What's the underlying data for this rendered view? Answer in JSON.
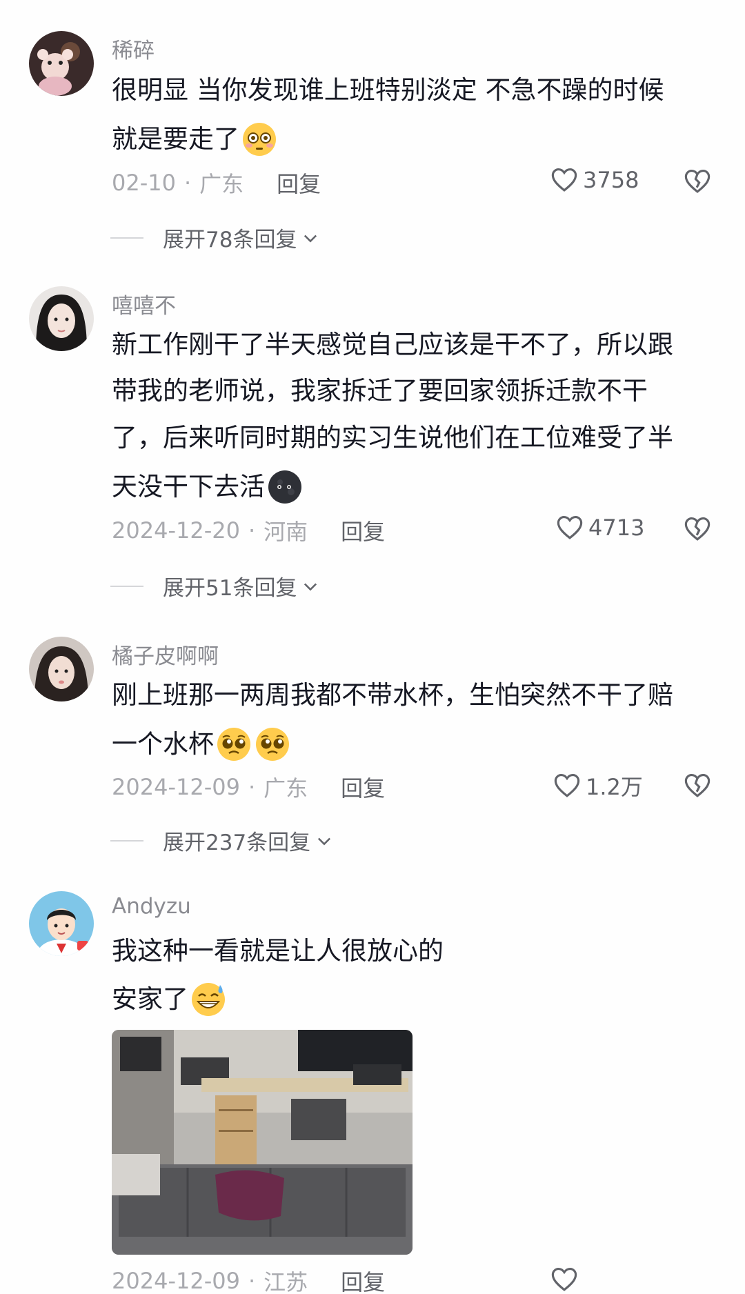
{
  "comments": [
    {
      "username": "稀碎",
      "lines": [
        "很明显 当你发现谁上班特别淡定 不急不躁的时候",
        "就是要走了"
      ],
      "emoji": "flushed-face-emoji",
      "date": "02-10",
      "region": "广东",
      "reply_label": "回复",
      "likes": "3758",
      "expand_label": "展开78条回复"
    },
    {
      "username": "嘻嘻不",
      "lines": [
        "新工作刚干了半天感觉自己应该是干不了，所以跟",
        "带我的老师说，我家拆迁了要回家领拆迁款不干",
        "了，后来听同时期的实习生说他们在工位难受了半",
        "天没干下去活"
      ],
      "emoji": "dark-moon-face-emoji",
      "date": "2024-12-20",
      "region": "河南",
      "reply_label": "回复",
      "likes": "4713",
      "expand_label": "展开51条回复"
    },
    {
      "username": "橘子皮啊啊",
      "lines": [
        "刚上班那一两周我都不带水杯，生怕突然不干了赔",
        "一个水杯"
      ],
      "emoji": "pleading-face-emoji",
      "date": "2024-12-09",
      "region": "广东",
      "reply_label": "回复",
      "likes": "1.2万",
      "expand_label": "展开237条回复"
    },
    {
      "username": "Andyzu",
      "lines": [
        "我这种一看就是让人很放心的",
        "安家了"
      ],
      "emoji": "grinning-sweat-emoji",
      "date": "2024-12-09",
      "region": "江苏",
      "reply_label": "回复"
    }
  ],
  "colors": {
    "text": "#161823",
    "username": "#8a8b91",
    "meta": "#a8a9ae",
    "action": "#616369",
    "background": "#fefefe"
  }
}
